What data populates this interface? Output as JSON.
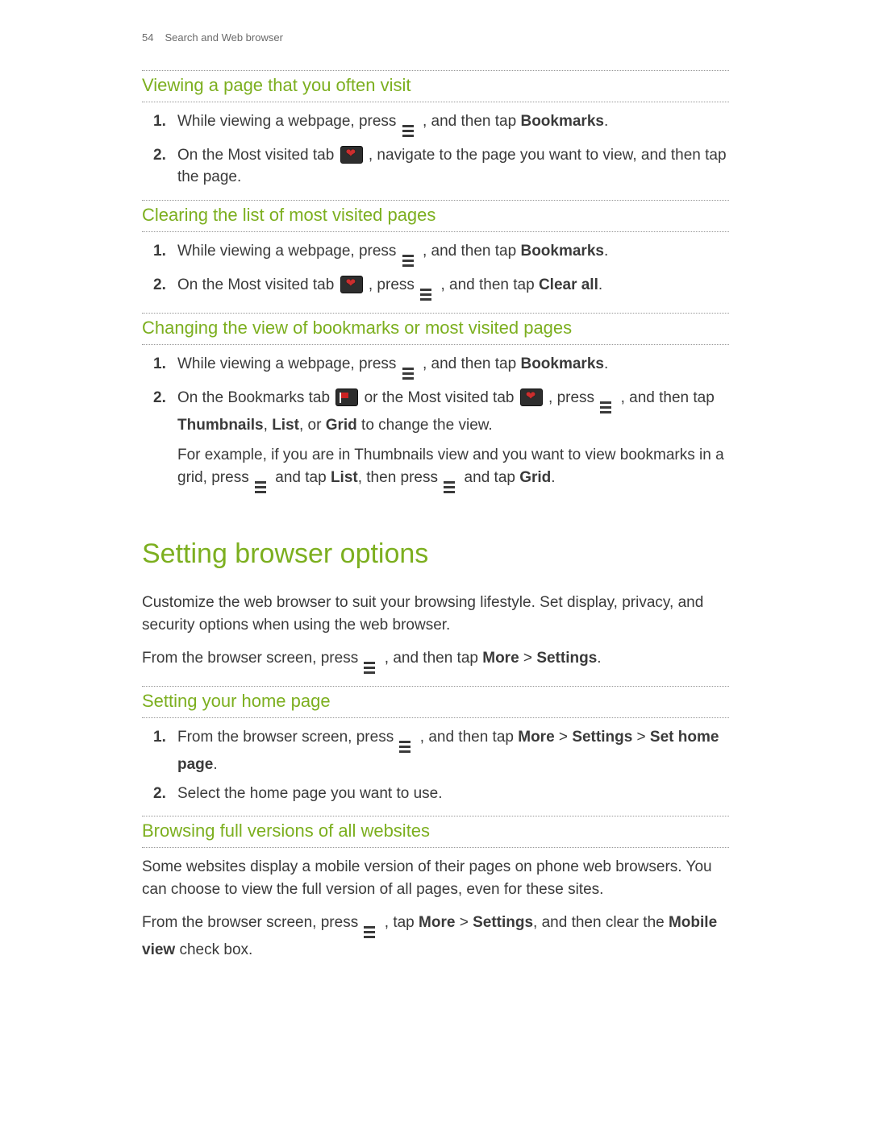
{
  "header": {
    "page_num": "54",
    "section": "Search and Web browser"
  },
  "s1": {
    "title": "Viewing a page that you often visit",
    "li1_a": "While viewing a webpage, press ",
    "li1_b": " , and then tap ",
    "li1_bold": "Bookmarks",
    "li1_c": ".",
    "li2_a": "On the Most visited tab ",
    "li2_b": " , navigate to the page you want to view, and then tap the page."
  },
  "s2": {
    "title": "Clearing the list of most visited pages",
    "li1_a": "While viewing a webpage, press ",
    "li1_b": " , and then tap ",
    "li1_bold": "Bookmarks",
    "li1_c": ".",
    "li2_a": "On the Most visited tab ",
    "li2_b": " , press ",
    "li2_c": " , and then tap ",
    "li2_bold": "Clear all",
    "li2_d": "."
  },
  "s3": {
    "title": "Changing the view of bookmarks or most visited pages",
    "li1_a": "While viewing a webpage, press ",
    "li1_b": " , and then tap ",
    "li1_bold": "Bookmarks",
    "li1_c": ".",
    "li2_a": "On the Bookmarks tab ",
    "li2_b": " or the Most visited tab ",
    "li2_c": " , press ",
    "li2_d": " , and then tap ",
    "li2_bold1": "Thumbnails",
    "li2_e": ", ",
    "li2_bold2": "List",
    "li2_f": ", or ",
    "li2_bold3": "Grid",
    "li2_g": " to change the view.",
    "note_a": "For example, if you are in Thumbnails view and you want to view bookmarks in a grid, press ",
    "note_b": " and tap ",
    "note_bold1": "List",
    "note_c": ", then press ",
    "note_d": " and tap ",
    "note_bold2": "Grid",
    "note_e": "."
  },
  "big": {
    "title": "Setting browser options",
    "p1": "Customize the web browser to suit your browsing lifestyle. Set display, privacy, and security options when using the web browser.",
    "p2_a": "From the browser screen, press ",
    "p2_b": " , and then tap ",
    "p2_bold1": "More",
    "p2_c": " > ",
    "p2_bold2": "Settings",
    "p2_d": "."
  },
  "s4": {
    "title": "Setting your home page",
    "li1_a": "From the browser screen, press ",
    "li1_b": " , and then tap ",
    "li1_bold1": "More",
    "li1_c": " > ",
    "li1_bold2": "Settings",
    "li1_d": " > ",
    "li1_bold3": "Set home page",
    "li1_e": ".",
    "li2": "Select the home page you want to use."
  },
  "s5": {
    "title": "Browsing full versions of all websites",
    "p1": "Some websites display a mobile version of their pages on phone web browsers. You can choose to view the full version of all pages, even for these sites.",
    "p2_a": "From the browser screen, press ",
    "p2_b": " , tap ",
    "p2_bold1": "More",
    "p2_c": " > ",
    "p2_bold2": "Settings",
    "p2_d": ", and then clear the ",
    "p2_bold3": "Mobile view",
    "p2_e": " check box."
  }
}
